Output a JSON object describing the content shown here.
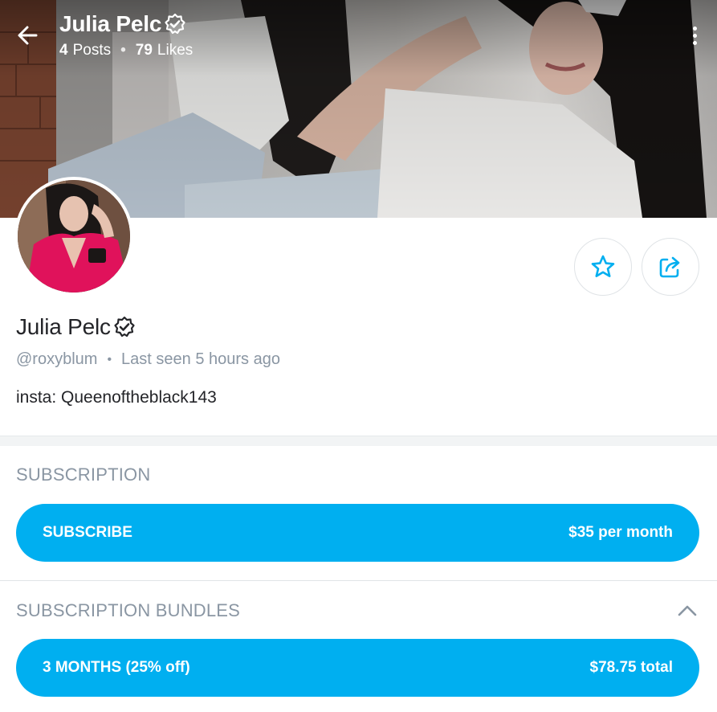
{
  "header": {
    "name": "Julia Pelc",
    "posts_count": "4",
    "posts_label": "Posts",
    "likes_count": "79",
    "likes_label": "Likes"
  },
  "profile": {
    "name": "Julia Pelc",
    "username": "@roxyblum",
    "last_seen": "Last seen 5 hours ago",
    "bio": "insta: Queenoftheblack143"
  },
  "subscription": {
    "title": "SUBSCRIPTION",
    "button_label": "SUBSCRIBE",
    "button_price": "$35 per month"
  },
  "bundles": {
    "title": "SUBSCRIPTION BUNDLES",
    "items": [
      {
        "label": "3 MONTHS (25% off)",
        "price": "$78.75 total"
      }
    ]
  },
  "colors": {
    "accent": "#00aff0",
    "muted_text": "#8a96a3",
    "primary_text": "#242529"
  },
  "icons": {
    "back": "arrow-left-icon",
    "verified": "verified-badge-icon",
    "more": "more-vertical-icon",
    "star": "star-icon",
    "share": "share-icon",
    "collapse": "chevron-up-icon"
  }
}
